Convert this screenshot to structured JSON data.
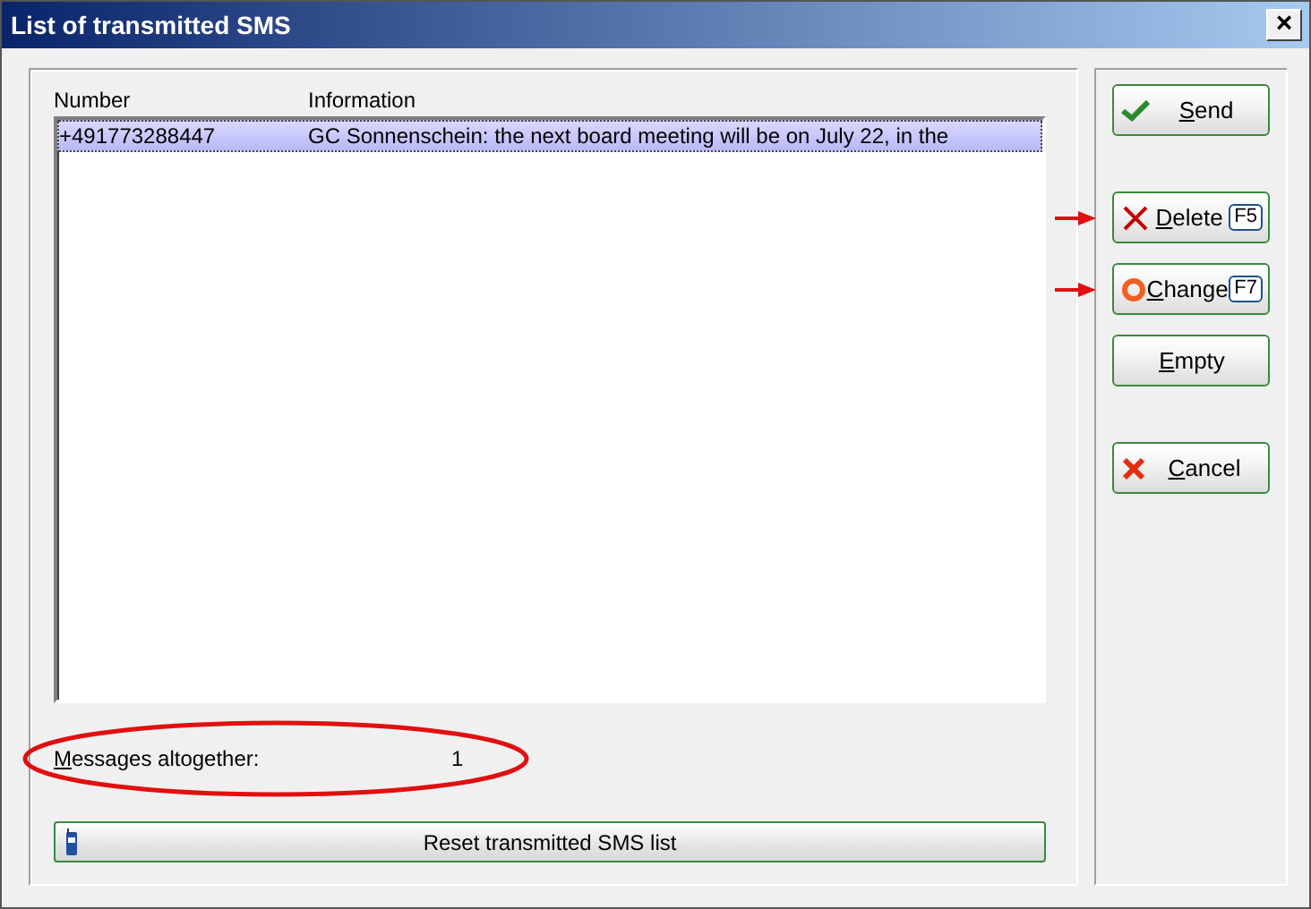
{
  "window": {
    "title": "List of transmitted SMS",
    "close": "×"
  },
  "list": {
    "columns": [
      "Number",
      "Information"
    ],
    "rows": [
      {
        "number": "+491773288447",
        "information": "GC Sonnenschein: the next board meeting will be on July 22, in the",
        "selected": true
      }
    ]
  },
  "summary": {
    "label": "Messages altogether:",
    "value": "1",
    "circled": true
  },
  "reset_button": {
    "label": "Reset transmitted SMS list"
  },
  "buttons": [
    {
      "label": "Send",
      "kind": "check",
      "arrow": false
    },
    {
      "label": "Delete",
      "kind": "cross",
      "shortcut": "F5",
      "arrow": true
    },
    {
      "label": "Change",
      "kind": "ring",
      "shortcut": "F7",
      "arrow": true
    },
    {
      "label": "Empty",
      "kind": "plain",
      "arrow": false
    },
    {
      "label": "Cancel",
      "kind": "cancel",
      "arrow": false
    }
  ]
}
